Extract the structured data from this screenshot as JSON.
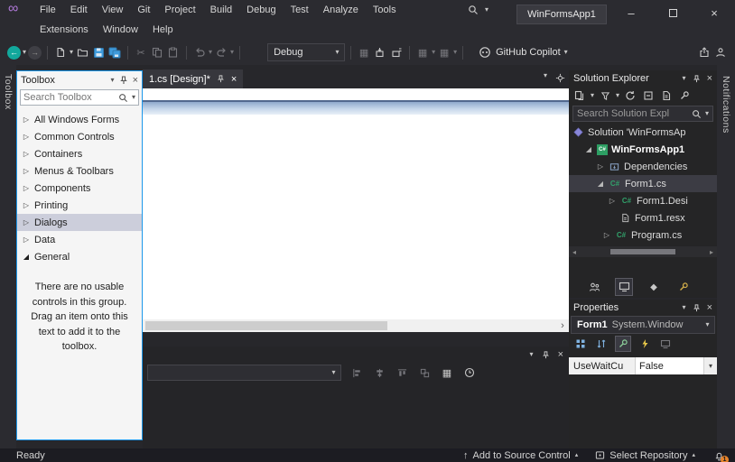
{
  "icons": {
    "logo": "∞",
    "caret": "▾",
    "caret_up": "▴",
    "collapsed": "▷",
    "expanded": "◢",
    "close": "×",
    "minimize": "–",
    "back": "←",
    "forward": "→",
    "cut": "✂",
    "grid": "▦",
    "scroll_left": "◂",
    "scroll_right": "▸",
    "more": "›",
    "arrow_up": "↑",
    "diamond": "◆"
  },
  "colors": {
    "accent_blue": "#1c97ea",
    "copilot_chrome": "#2b2b30",
    "toolbox_selection": "#cccedb",
    "tree_selection_dark": "#3c3c44",
    "badge_orange": "#e8842c",
    "project_green": "#2d9e63"
  },
  "menu": {
    "row1": [
      "File",
      "Edit",
      "View",
      "Git",
      "Project",
      "Build",
      "Debug",
      "Test",
      "Analyze",
      "Tools"
    ],
    "row2": [
      "Extensions",
      "Window",
      "Help"
    ]
  },
  "titlebar": {
    "app_search": "WinFormsApp1"
  },
  "toolbar": {
    "debug_target": "Debug",
    "copilot_label": "GitHub Copilot"
  },
  "vertical_tabs": {
    "left": "Toolbox",
    "right": "Notifications"
  },
  "toolbox": {
    "title": "Toolbox",
    "search_placeholder": "Search Toolbox",
    "groups": [
      "All Windows Forms",
      "Common Controls",
      "Containers",
      "Menus & Toolbars",
      "Components",
      "Printing",
      "Dialogs",
      "Data",
      "General"
    ],
    "selected_group": "Dialogs",
    "expanded_group": "General",
    "empty_text": "There are no usable controls in this group. Drag an item onto this text to add it to the toolbox."
  },
  "editor": {
    "tab_label": "1.cs [Design]*"
  },
  "solution_explorer": {
    "title": "Solution Explorer",
    "search_placeholder": "Search Solution Expl",
    "items": [
      {
        "label": "Solution 'WinFormsAp"
      },
      {
        "label": "WinFormsApp1"
      },
      {
        "label": "Dependencies"
      },
      {
        "label": "Form1.cs"
      },
      {
        "label": "Form1.Desi"
      },
      {
        "label": "Form1.resx"
      },
      {
        "label": "Program.cs"
      }
    ],
    "selected_item": "Form1.cs"
  },
  "properties": {
    "title": "Properties",
    "object_name": "Form1",
    "object_type": "System.Window",
    "row": {
      "name": "UseWaitCu",
      "value": "False"
    }
  },
  "status": {
    "ready": "Ready",
    "add_to_source_control": "Add to Source Control",
    "select_repository": "Select Repository",
    "notification_badge": "1"
  }
}
